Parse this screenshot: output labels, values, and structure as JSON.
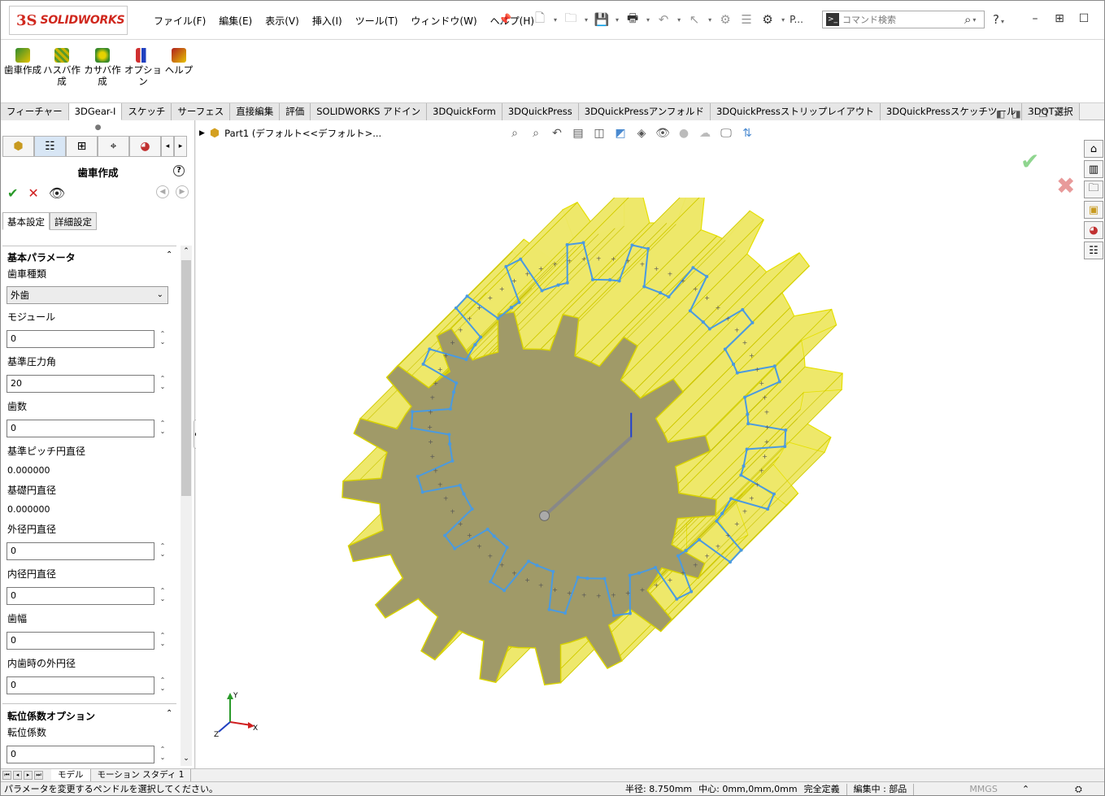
{
  "app": {
    "logo_ds": "3S",
    "logo_text": "SOLIDWORKS",
    "menu": [
      "ファイル(F)",
      "編集(E)",
      "表示(V)",
      "挿入(I)",
      "ツール(T)",
      "ウィンドウ(W)",
      "ヘルプ(H)"
    ],
    "quick_access_label": "P...",
    "search_placeholder": "コマンド検索",
    "help_label": "?"
  },
  "ribbon": {
    "buttons": [
      {
        "label": "歯車作成",
        "icon": "gear-make-icon"
      },
      {
        "label": "ハスバ作成",
        "icon": "helical-gear-icon"
      },
      {
        "label": "カサバ作成",
        "icon": "bevel-gear-icon"
      },
      {
        "label": "オプション",
        "icon": "options-icon"
      },
      {
        "label": "ヘルプ",
        "icon": "help-icon"
      }
    ],
    "accent_colors": [
      "#2e8b2e",
      "#c8b400",
      "#7aa61a",
      "#d03030",
      "#b02020"
    ]
  },
  "tabs": [
    "フィーチャー",
    "3DGear-I",
    "スケッチ",
    "サーフェス",
    "直接編集",
    "評価",
    "SOLIDWORKS アドイン",
    "3DQuickForm",
    "3DQuickPress",
    "3DQuickPressアンフォルド",
    "3DQuickPressストリップレイアウト",
    "3DQuickPressスケッチツール",
    "3DQT選択"
  ],
  "active_tab": "3DGear-I",
  "panel": {
    "title": "歯車作成",
    "subtabs": [
      "基本設定",
      "詳細設定"
    ],
    "group1_title": "基本パラメータ",
    "gear_type_label": "歯車種類",
    "gear_type_value": "外歯",
    "module_label": "モジュール",
    "module_value": "0",
    "pressure_angle_label": "基準圧力角",
    "pressure_angle_value": "20",
    "teeth_label": "歯数",
    "teeth_value": "0",
    "pitch_diameter_label": "基準ピッチ円直径",
    "pitch_diameter_value": "0.000000",
    "base_diameter_label": "基礎円直径",
    "base_diameter_value": "0.000000",
    "outer_diameter_label": "外径円直径",
    "outer_diameter_value": "0",
    "inner_diameter_label": "内径円直径",
    "inner_diameter_value": "0",
    "face_width_label": "歯幅",
    "face_width_value": "0",
    "internal_outer_label": "内歯時の外円径",
    "internal_outer_value": "0",
    "group2_title": "転位係数オプション",
    "shift_label": "転位係数",
    "shift_value": "0"
  },
  "viewport": {
    "breadcrumb": "Part1  (デフォルト<<デフォルト>...",
    "gear_face_color": "#a09a68",
    "gear_side_color": "#ede86a",
    "gear_edge_color": "#e6e000",
    "sketch_color": "#4a9ae0"
  },
  "bottom_tabs": [
    "モデル",
    "モーション スタディ 1"
  ],
  "status": {
    "message": "パラメータを変更するペンドルを選択してください。",
    "radius": "半径: 8.750mm",
    "center": "中心: 0mm,0mm,0mm",
    "defined": "完全定義",
    "editing": "編集中 : 部品",
    "units": "MMGS"
  }
}
